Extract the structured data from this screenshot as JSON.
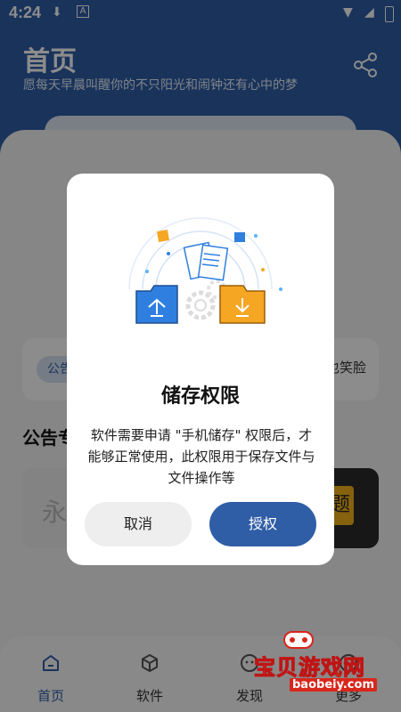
{
  "status_bar": {
    "time": "4:24"
  },
  "header": {
    "title": "首页",
    "subtitle": "愿每天早晨叫醒你的不只阳光和闹钟还有心中的梦"
  },
  "notice": {
    "tag": "公告",
    "text": "也笑脸"
  },
  "section": {
    "title": "公告专"
  },
  "banners": {
    "left_char": "永",
    "right_char": "题"
  },
  "bottom_nav": [
    {
      "label": "首页",
      "icon": "home-icon"
    },
    {
      "label": "软件",
      "icon": "cube-icon"
    },
    {
      "label": "发现",
      "icon": "discover-icon"
    },
    {
      "label": "更多",
      "icon": "more-icon"
    }
  ],
  "dialog": {
    "title": "储存权限",
    "message": "软件需要申请 \"手机储存\" 权限后，才能够正常使用，此权限用于保存文件与文件操作等",
    "cancel_label": "取消",
    "confirm_label": "授权"
  },
  "watermark": {
    "text": "宝贝游戏网",
    "url": "baobeiy.com"
  },
  "colors": {
    "primary": "#2f5ea6",
    "folder_blue": "#2f7fe0",
    "folder_orange": "#f5a623",
    "dialog_bg": "#ffffff"
  }
}
